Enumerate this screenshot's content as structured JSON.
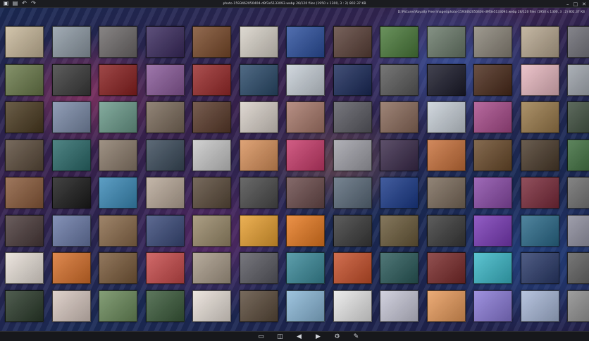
{
  "window": {
    "title": "photo-1593462050404-d9f3e5133093.webp 26/120 files (1950 x 1300, 3 : 2) 802.37 KB",
    "file_path": "D:\\Pictures\\Royalty Free Images\\photo-1593462050404-d9f3e5133093.webp 26/120 files (1950 x 1300, 3 : 2) 802.37 KB"
  },
  "titlebar_icons": [
    "app-menu-icon",
    "save-icon",
    "undo-icon",
    "redo-icon"
  ],
  "window_controls": [
    "minimize-icon",
    "maximize-icon",
    "close-icon"
  ],
  "toolbar": {
    "buttons": [
      {
        "name": "open-folder-icon",
        "glyph": "▭"
      },
      {
        "name": "fullscreen-icon",
        "glyph": "◫"
      },
      {
        "name": "previous-icon",
        "glyph": "◀"
      },
      {
        "name": "next-icon",
        "glyph": "▶"
      },
      {
        "name": "settings-icon",
        "glyph": "⚙"
      },
      {
        "name": "tools-icon",
        "glyph": "✎"
      }
    ]
  },
  "grid": {
    "columns": 13,
    "rows": 8,
    "thumb_colors": [
      [
        "#c8b89a",
        "#8e9aa5",
        "#6e6a6a",
        "#3a2a5e",
        "#7a4a2a",
        "#d8d2c8",
        "#2b4f9e",
        "#5a4038",
        "#4a7a3a",
        "#6a7a6a",
        "#8a8478",
        "#b8a890",
        "#6a6a72"
      ],
      [
        "#6a7a4a",
        "#3a3a3a",
        "#8a2020",
        "#8a5a9a",
        "#9a2a2a",
        "#2a4a6a",
        "#c8d0d8",
        "#1a2a5a",
        "#5a5a5a",
        "#1a1a2a",
        "#4a2a1a",
        "#e8b8c0",
        "#9aa0a8"
      ],
      [
        "#4a3a20",
        "#7a8aa8",
        "#6a9a8a",
        "#7a6a5a",
        "#5a3a2a",
        "#d8d0c8",
        "#a8786a",
        "#5a5a62",
        "#8a6a5a",
        "#c8d0d8",
        "#a84a8a",
        "#9a7a4a",
        "#3a4a3a"
      ],
      [
        "#5a4a3a",
        "#2a6a6a",
        "#8a7a6a",
        "#3a4a5a",
        "#c8c8c8",
        "#d8905a",
        "#c83a6a",
        "#a0a0a8",
        "#3a2a4a",
        "#c8703a",
        "#6a4a2a",
        "#4a3a2a",
        "#3a6a3a"
      ],
      [
        "#8a5a3a",
        "#1a1a1a",
        "#3a8ab8",
        "#b8a898",
        "#5a4a3a",
        "#4a4a4a",
        "#6a4a4a",
        "#5a6a7a",
        "#1a3a8a",
        "#7a6a5a",
        "#8a4aa8",
        "#7a2a3a",
        "#6a6a6a"
      ],
      [
        "#4a3a3a",
        "#6a7aa8",
        "#8a6a4a",
        "#3a4a7a",
        "#9a8a6a",
        "#e8a030",
        "#e87a20",
        "#3a3a3a",
        "#6a5a3a",
        "#3a3a3a",
        "#7a3ab8",
        "#2a6a8a",
        "#8a8a9a"
      ],
      [
        "#e8e0d8",
        "#d8702a",
        "#7a5a3a",
        "#c84a4a",
        "#a89a88",
        "#5a5a62",
        "#3a8a9a",
        "#c8502a",
        "#2a5a5a",
        "#7a2a2a",
        "#3ab8c8",
        "#2a3a6a",
        "#5a5a5a"
      ],
      [
        "#2a3a2a",
        "#d8c8c0",
        "#6a8a5a",
        "#3a5a3a",
        "#e8e0d8",
        "#5a4a3a",
        "#8ab8d8",
        "#e8e8e8",
        "#c8c8d8",
        "#e89a5a",
        "#8a7ad8",
        "#a8b8d8",
        "#8a8a8a"
      ]
    ]
  }
}
